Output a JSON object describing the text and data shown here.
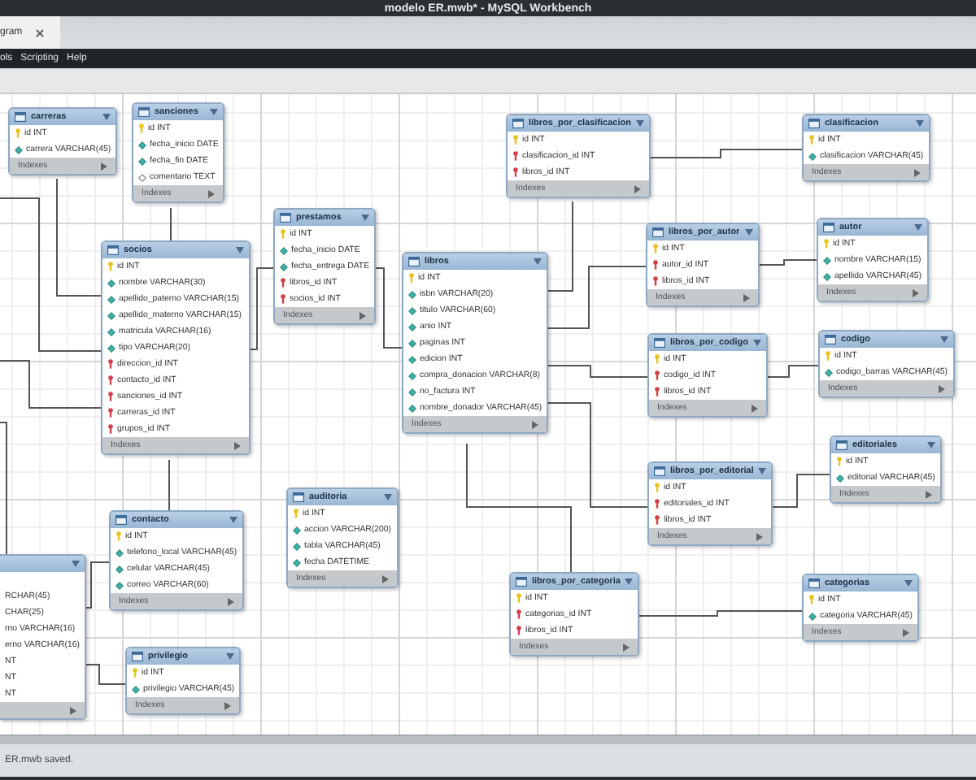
{
  "window": {
    "title": "modelo ER.mwb* - MySQL Workbench"
  },
  "tabs": [
    {
      "label": "gram",
      "selected": true
    }
  ],
  "menu": [
    "ols",
    "Scripting",
    "Help"
  ],
  "tables": [
    {
      "name": "carreras",
      "footer": "Indexes",
      "columns": [
        {
          "kind": "pk",
          "text": "id INT"
        },
        {
          "kind": "col",
          "text": "carrera VARCHAR(45)"
        }
      ]
    },
    {
      "name": "sanciones",
      "footer": "Indexes",
      "columns": [
        {
          "kind": "pk",
          "text": "id INT"
        },
        {
          "kind": "col",
          "text": "fecha_inicio DATE"
        },
        {
          "kind": "col",
          "text": "fecha_fin DATE"
        },
        {
          "kind": "nullable",
          "text": "comentario TEXT"
        }
      ]
    },
    {
      "name": "libros_por_clasificacion",
      "footer": "Indexes",
      "columns": [
        {
          "kind": "pk",
          "text": "id INT"
        },
        {
          "kind": "fk",
          "text": "clasificacion_id INT"
        },
        {
          "kind": "fk",
          "text": "libros_id INT"
        }
      ]
    },
    {
      "name": "clasificacion",
      "footer": "Indexes",
      "columns": [
        {
          "kind": "pk",
          "text": "id INT"
        },
        {
          "kind": "col",
          "text": "clasificacion VARCHAR(45)"
        }
      ]
    },
    {
      "name": "prestamos",
      "footer": "Indexes",
      "columns": [
        {
          "kind": "pk",
          "text": "id INT"
        },
        {
          "kind": "col",
          "text": "fecha_inicio DATE"
        },
        {
          "kind": "col",
          "text": "fecha_entrega DATE"
        },
        {
          "kind": "fk",
          "text": "libros_id INT"
        },
        {
          "kind": "fk",
          "text": "socios_id INT"
        }
      ]
    },
    {
      "name": "libros_por_autor",
      "footer": "Indexes",
      "columns": [
        {
          "kind": "pk",
          "text": "id INT"
        },
        {
          "kind": "fk",
          "text": "autor_id INT"
        },
        {
          "kind": "fk",
          "text": "libros_id INT"
        }
      ]
    },
    {
      "name": "autor",
      "footer": "Indexes",
      "columns": [
        {
          "kind": "pk",
          "text": "id INT"
        },
        {
          "kind": "col",
          "text": "nombre VARCHAR(15)"
        },
        {
          "kind": "col",
          "text": "apellido VARCHAR(45)"
        }
      ]
    },
    {
      "name": "socios",
      "footer": "Indexes",
      "columns": [
        {
          "kind": "pk",
          "text": "id INT"
        },
        {
          "kind": "col",
          "text": "nombre VARCHAR(30)"
        },
        {
          "kind": "col",
          "text": "apellido_paterno VARCHAR(15)"
        },
        {
          "kind": "col",
          "text": "apellido_materno VARCHAR(15)"
        },
        {
          "kind": "col",
          "text": "matricula VARCHAR(16)"
        },
        {
          "kind": "col",
          "text": "tipo VARCHAR(20)"
        },
        {
          "kind": "fk",
          "text": "direccion_id INT"
        },
        {
          "kind": "fk",
          "text": "contacto_id INT"
        },
        {
          "kind": "fk",
          "text": "sanciones_id INT"
        },
        {
          "kind": "fk",
          "text": "carreras_id INT"
        },
        {
          "kind": "fk",
          "text": "grupos_id INT"
        }
      ]
    },
    {
      "name": "libros",
      "footer": "Indexes",
      "columns": [
        {
          "kind": "pk",
          "text": "id INT"
        },
        {
          "kind": "col",
          "text": "isbn VARCHAR(20)"
        },
        {
          "kind": "col",
          "text": "titulo VARCHAR(60)"
        },
        {
          "kind": "col",
          "text": "anio INT"
        },
        {
          "kind": "col",
          "text": "paginas INT"
        },
        {
          "kind": "col",
          "text": "edicion INT"
        },
        {
          "kind": "col",
          "text": "compra_donacion VARCHAR(8)"
        },
        {
          "kind": "col",
          "text": "no_factura INT"
        },
        {
          "kind": "col",
          "text": "nombre_donador VARCHAR(45)"
        }
      ]
    },
    {
      "name": "libros_por_codigo",
      "footer": "Indexes",
      "columns": [
        {
          "kind": "pk",
          "text": "id INT"
        },
        {
          "kind": "fk",
          "text": "codigo_id INT"
        },
        {
          "kind": "fk",
          "text": "libros_id INT"
        }
      ]
    },
    {
      "name": "codigo",
      "footer": "Indexes",
      "columns": [
        {
          "kind": "pk",
          "text": "id INT"
        },
        {
          "kind": "col",
          "text": "codigo_barras VARCHAR(45)"
        }
      ]
    },
    {
      "name": "editoriales",
      "footer": "Indexes",
      "columns": [
        {
          "kind": "pk",
          "text": "id INT"
        },
        {
          "kind": "col",
          "text": "editorial VARCHAR(45)"
        }
      ]
    },
    {
      "name": "libros_por_editorial",
      "footer": "Indexes",
      "columns": [
        {
          "kind": "pk",
          "text": "id INT"
        },
        {
          "kind": "fk",
          "text": "editoriales_id INT"
        },
        {
          "kind": "fk",
          "text": "libros_id INT"
        }
      ]
    },
    {
      "name": "auditoria",
      "footer": "Indexes",
      "columns": [
        {
          "kind": "pk",
          "text": "id INT"
        },
        {
          "kind": "col",
          "text": "accion VARCHAR(200)"
        },
        {
          "kind": "col",
          "text": "tabla VARCHAR(45)"
        },
        {
          "kind": "col",
          "text": "fecha DATETIME"
        }
      ]
    },
    {
      "name": "contacto",
      "footer": "Indexes",
      "columns": [
        {
          "kind": "pk",
          "text": "id INT"
        },
        {
          "kind": "col",
          "text": "telefono_local VARCHAR(45)"
        },
        {
          "kind": "col",
          "text": "celular VARCHAR(45)"
        },
        {
          "kind": "col",
          "text": "correo VARCHAR(60)"
        }
      ]
    },
    {
      "columns": [
        {
          "kind": "partial",
          "text": "RCHAR(45)"
        },
        {
          "kind": "partial",
          "text": "CHAR(25)"
        },
        {
          "kind": "partial",
          "text": "rno VARCHAR(16)"
        },
        {
          "kind": "partial",
          "text": "erno VARCHAR(16)"
        },
        {
          "kind": "partial",
          "text": "NT"
        },
        {
          "kind": "partial",
          "text": "NT"
        },
        {
          "kind": "partial",
          "text": "NT"
        }
      ]
    },
    {
      "name": "libros_por_categoria",
      "footer": "Indexes",
      "columns": [
        {
          "kind": "pk",
          "text": "id INT"
        },
        {
          "kind": "fk",
          "text": "categorias_id INT"
        },
        {
          "kind": "fk",
          "text": "libros_id INT"
        }
      ]
    },
    {
      "name": "categorias",
      "footer": "Indexes",
      "columns": [
        {
          "kind": "pk",
          "text": "id INT"
        },
        {
          "kind": "col",
          "text": "categoria VARCHAR(45)"
        }
      ]
    },
    {
      "name": "privilegio",
      "footer": "Indexes",
      "columns": [
        {
          "kind": "pk",
          "text": "id INT"
        },
        {
          "kind": "col",
          "text": "privilegio VARCHAR(45)"
        }
      ]
    }
  ],
  "status_bar": {
    "text": "ER.mwb saved."
  }
}
